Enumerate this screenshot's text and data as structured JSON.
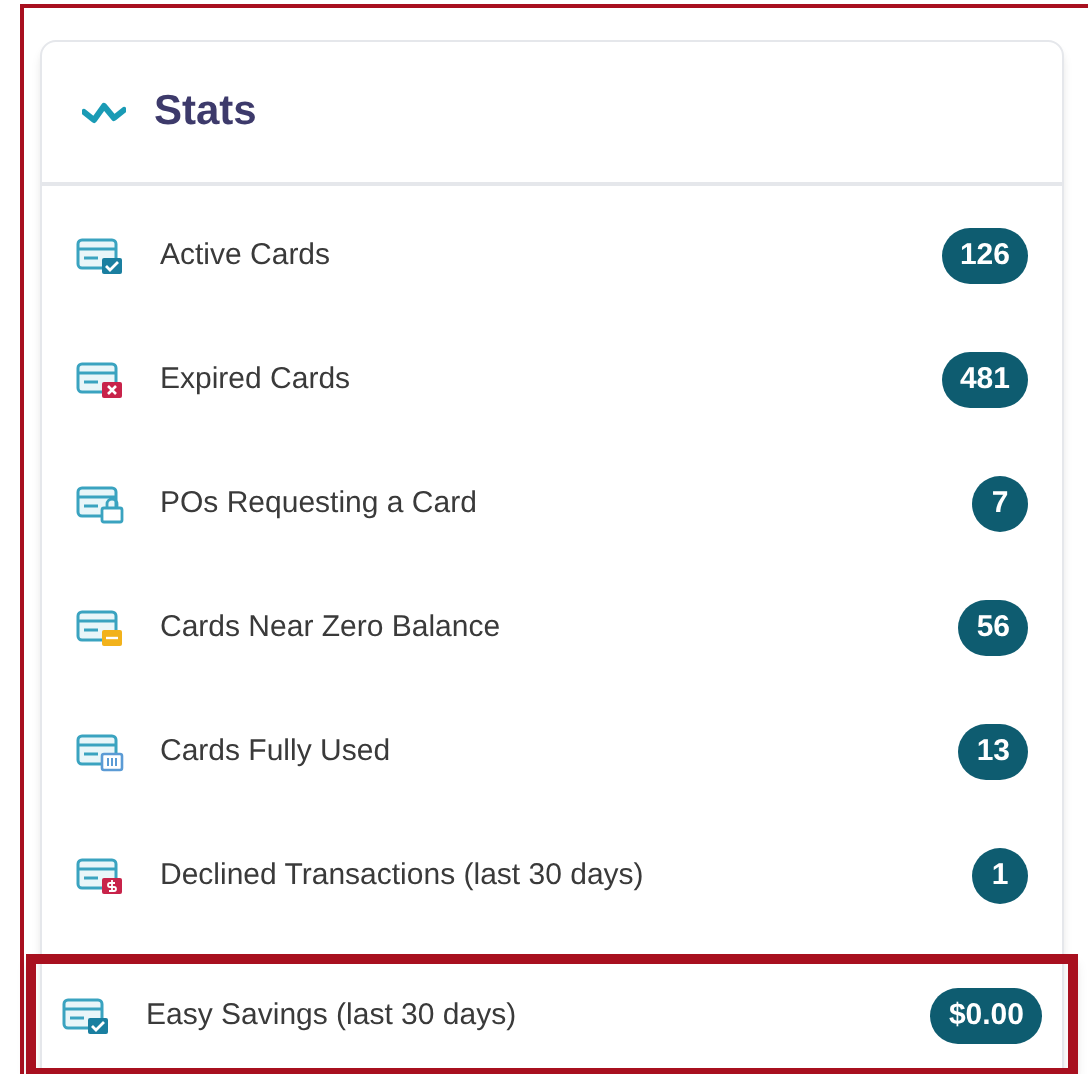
{
  "panel": {
    "title": "Stats"
  },
  "items": [
    {
      "label": "Active Cards",
      "count": "126",
      "kind": "check",
      "highlighted": false
    },
    {
      "label": "Expired Cards",
      "count": "481",
      "kind": "cross",
      "highlighted": false
    },
    {
      "label": "POs Requesting a Card",
      "count": "7",
      "kind": "lock",
      "highlighted": false
    },
    {
      "label": "Cards Near Zero Balance",
      "count": "56",
      "kind": "bar",
      "highlighted": false
    },
    {
      "label": "Cards Fully Used",
      "count": "13",
      "kind": "list",
      "highlighted": false
    },
    {
      "label": "Declined Transactions (last 30 days)",
      "count": "1",
      "kind": "dollar",
      "highlighted": false
    },
    {
      "label": "Easy Savings (last 30 days)",
      "count": "$0.00",
      "kind": "check",
      "highlighted": true
    }
  ]
}
